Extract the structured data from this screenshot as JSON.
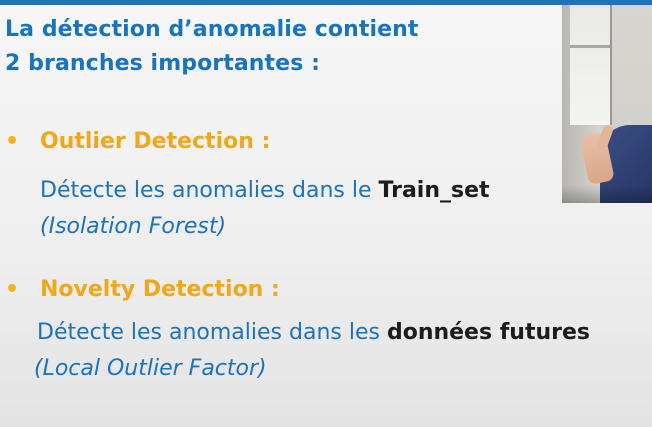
{
  "slide": {
    "title_line1": "La détection d’anomalie contient",
    "title_line2": "2 branches importantes :",
    "bullet_glyph": "•",
    "branches": [
      {
        "heading": "Outlier Detection :",
        "desc_prefix": "Détecte les anomalies dans le ",
        "desc_emphasis": "Train_set",
        "method": "(Isolation Forest)"
      },
      {
        "heading": "Novelty Detection :",
        "desc_prefix": "Détecte les anomalies dans les ",
        "desc_emphasis": "données futures",
        "method": "(Local Outlier Factor)"
      }
    ]
  },
  "colors": {
    "title": "#1874bd",
    "heading": "#f0a81b",
    "body": "#1d72b8",
    "emphasis": "#1c1c1c",
    "top_bar": "#2a6fb6"
  },
  "overlay": {
    "webcam_icon": "presenter-webcam-feed"
  }
}
